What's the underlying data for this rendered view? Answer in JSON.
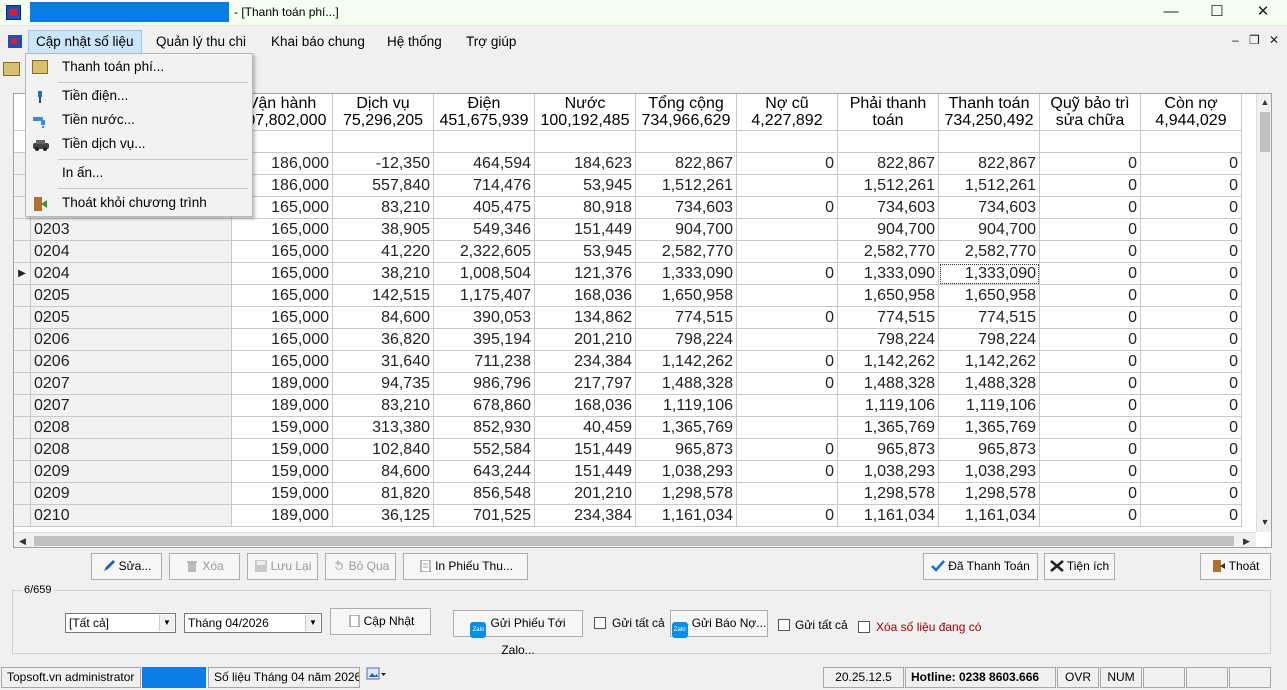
{
  "window": {
    "title": "- [Thanh toán phí...]",
    "minimize": "—",
    "maximize": "☐",
    "close": "✕"
  },
  "menu": {
    "items": [
      "Cập nhật số liệu",
      "Quản lý thu chi",
      "Khai báo chung",
      "Hệ thống",
      "Trợ giúp"
    ],
    "mdi_min": "–",
    "mdi_restore": "❐",
    "mdi_close": "✕"
  },
  "dropdown": {
    "items": [
      "Thanh toán phí...",
      "Tiền điện...",
      "Tiền nước...",
      "Tiền dịch vụ...",
      "In ấn...",
      "Thoát khỏi chương trình"
    ]
  },
  "grid": {
    "headers": [
      {
        "l1": "",
        "l2": ""
      },
      {
        "l1": "",
        "l2": ""
      },
      {
        "l1": "Vận hành",
        "l2": "107,802,000"
      },
      {
        "l1": "Dịch vụ",
        "l2": "75,296,205"
      },
      {
        "l1": "Điện",
        "l2": "451,675,939"
      },
      {
        "l1": "Nước",
        "l2": "100,192,485"
      },
      {
        "l1": "Tổng cộng",
        "l2": "734,966,629"
      },
      {
        "l1": "Nợ cũ",
        "l2": "4,227,892"
      },
      {
        "l1": "Phải thanh",
        "l2": "toán"
      },
      {
        "l1": "Thanh toán",
        "l2": "734,250,492"
      },
      {
        "l1": "Quỹ bảo trì",
        "l2": "sửa chữa"
      },
      {
        "l1": "Còn nợ",
        "l2": "4,944,029"
      }
    ],
    "rows": [
      [
        "",
        "186,000",
        "-12,350",
        "464,594",
        "184,623",
        "822,867",
        "0",
        "822,867",
        "822,867",
        "0",
        "0"
      ],
      [
        "",
        "186,000",
        "557,840",
        "714,476",
        "53,945",
        "1,512,261",
        "",
        "1,512,261",
        "1,512,261",
        "0",
        "0"
      ],
      [
        "",
        "165,000",
        "83,210",
        "405,475",
        "80,918",
        "734,603",
        "0",
        "734,603",
        "734,603",
        "0",
        "0"
      ],
      [
        "0203",
        "165,000",
        "38,905",
        "549,346",
        "151,449",
        "904,700",
        "",
        "904,700",
        "904,700",
        "0",
        "0"
      ],
      [
        "0204",
        "165,000",
        "41,220",
        "2,322,605",
        "53,945",
        "2,582,770",
        "",
        "2,582,770",
        "2,582,770",
        "0",
        "0"
      ],
      [
        "0204",
        "165,000",
        "38,210",
        "1,008,504",
        "121,376",
        "1,333,090",
        "0",
        "1,333,090",
        "1,333,090",
        "0",
        "0"
      ],
      [
        "0205",
        "165,000",
        "142,515",
        "1,175,407",
        "168,036",
        "1,650,958",
        "",
        "1,650,958",
        "1,650,958",
        "0",
        "0"
      ],
      [
        "0205",
        "165,000",
        "84,600",
        "390,053",
        "134,862",
        "774,515",
        "0",
        "774,515",
        "774,515",
        "0",
        "0"
      ],
      [
        "0206",
        "165,000",
        "36,820",
        "395,194",
        "201,210",
        "798,224",
        "",
        "798,224",
        "798,224",
        "0",
        "0"
      ],
      [
        "0206",
        "165,000",
        "31,640",
        "711,238",
        "234,384",
        "1,142,262",
        "0",
        "1,142,262",
        "1,142,262",
        "0",
        "0"
      ],
      [
        "0207",
        "189,000",
        "94,735",
        "986,796",
        "217,797",
        "1,488,328",
        "0",
        "1,488,328",
        "1,488,328",
        "0",
        "0"
      ],
      [
        "0207",
        "189,000",
        "83,210",
        "678,860",
        "168,036",
        "1,119,106",
        "",
        "1,119,106",
        "1,119,106",
        "0",
        "0"
      ],
      [
        "0208",
        "159,000",
        "313,380",
        "852,930",
        "40,459",
        "1,365,769",
        "",
        "1,365,769",
        "1,365,769",
        "0",
        "0"
      ],
      [
        "0208",
        "159,000",
        "102,840",
        "552,584",
        "151,449",
        "965,873",
        "0",
        "965,873",
        "965,873",
        "0",
        "0"
      ],
      [
        "0209",
        "159,000",
        "84,600",
        "643,244",
        "151,449",
        "1,038,293",
        "0",
        "1,038,293",
        "1,038,293",
        "0",
        "0"
      ],
      [
        "0209",
        "159,000",
        "81,820",
        "856,548",
        "201,210",
        "1,298,578",
        "",
        "1,298,578",
        "1,298,578",
        "0",
        "0"
      ],
      [
        "0210",
        "189,000",
        "36,125",
        "701,525",
        "234,384",
        "1,161,034",
        "0",
        "1,161,034",
        "1,161,034",
        "0",
        "0"
      ]
    ],
    "current_row_marker": "▶"
  },
  "buttons": {
    "sua": "Sửa...",
    "xoa": "Xóa",
    "luu_lai": "Lưu Lại",
    "bo_qua": "Bỏ Qua",
    "in_phieu": "In Phiếu Thu...",
    "da_thanh_toan": "Đã Thanh Toán",
    "tien_ich": "Tiện ích",
    "thoat": "Thoát"
  },
  "filter": {
    "record_count": "6/659",
    "filter_value": "[Tất cả]",
    "month_value": "Tháng 04/2026",
    "cap_nhat": "Cập Nhật",
    "gui_phieu_zalo": "Gửi Phiếu Tới Zalo...",
    "gui_tat_ca_1": "Gửi tất cả",
    "gui_bao_no": "Gửi Báo Nợ...",
    "gui_tat_ca_2": "Gửi tất cả",
    "xoa_so_lieu": "Xóa số liệu đang có",
    "zalo_icon_text": "Zalo"
  },
  "status": {
    "user": "Topsoft.vn administrator",
    "period": "Số liệu Tháng 04 năm 2026",
    "version": "20.25.12.5",
    "hotline": "Hotline: 0238 8603.666",
    "ovr": "OVR",
    "num": "NUM"
  },
  "colors": {
    "title_blue": "#0a7ce6",
    "menu_highlight": "#cce4f7",
    "danger_text": "#a00000"
  }
}
